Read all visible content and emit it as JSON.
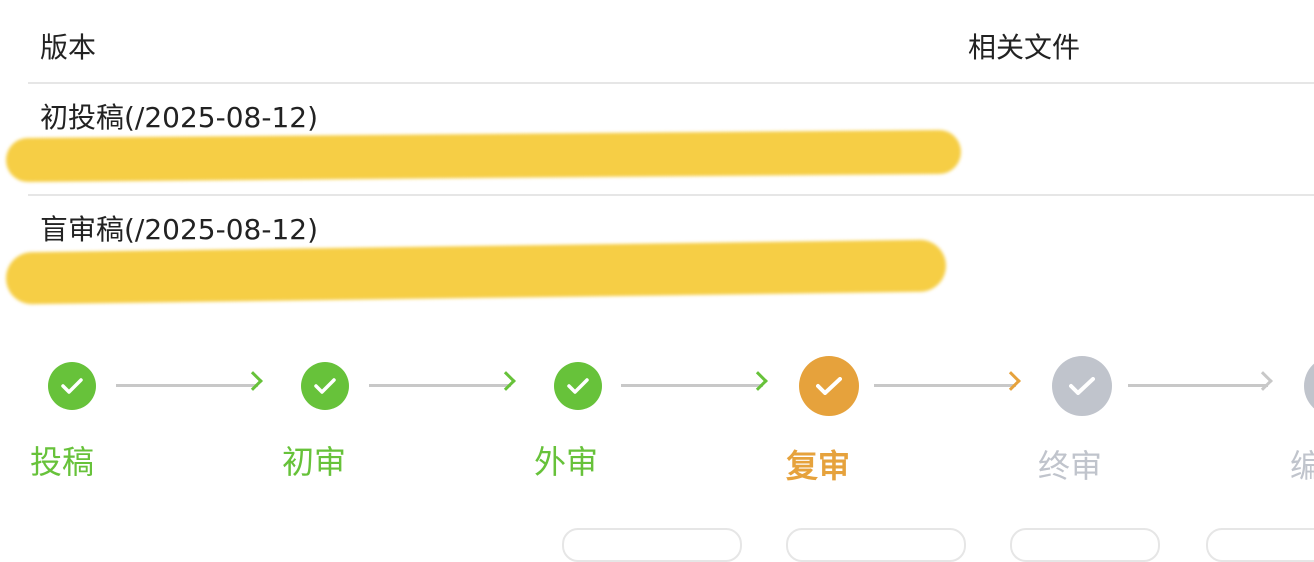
{
  "table": {
    "header_version": "版本",
    "header_files": "相关文件",
    "rows": [
      {
        "label": "初投稿(/2025-08-12)"
      },
      {
        "label": "盲审稿(/2025-08-12)"
      }
    ]
  },
  "steps": [
    {
      "label": "投稿",
      "status": "done",
      "color": "#67c23a"
    },
    {
      "label": "初审",
      "status": "done",
      "color": "#67c23a"
    },
    {
      "label": "外审",
      "status": "done",
      "color": "#67c23a"
    },
    {
      "label": "复审",
      "status": "current",
      "color": "#e6a23c"
    },
    {
      "label": "终审",
      "status": "pending",
      "color": "#c0c4cc"
    },
    {
      "label": "编",
      "status": "pending",
      "color": "#c0c4cc"
    }
  ],
  "icons": {
    "step_icon": "check-icon",
    "connector_icon": "chevron-right-icon"
  },
  "colors": {
    "done": "#67c23a",
    "current": "#e6a23c",
    "pending": "#c0c4cc",
    "connector_line": "#c8c8c8",
    "redaction": "#f6ce45",
    "divider": "#e6e6e6"
  }
}
